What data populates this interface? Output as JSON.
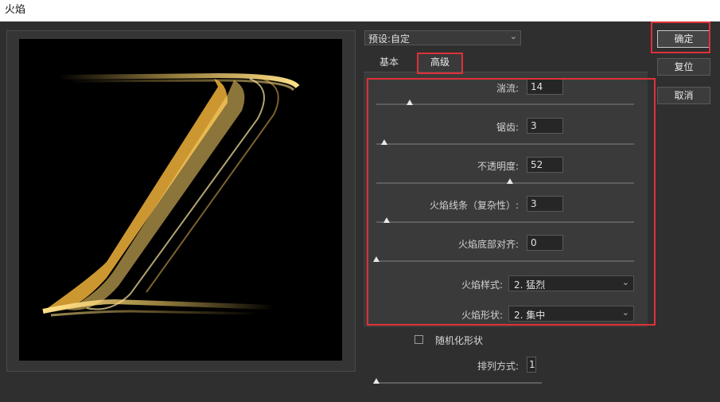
{
  "window": {
    "title": "火焰"
  },
  "preset": {
    "label": "预设:",
    "value": "自定"
  },
  "tabs": [
    {
      "label": "基本"
    },
    {
      "label": "高级"
    }
  ],
  "buttons": {
    "ok": "确定",
    "reset": "复位",
    "cancel": "取消"
  },
  "advanced": {
    "turbulence": {
      "label": "湍流:",
      "value": "14",
      "level": 0.13
    },
    "jagged": {
      "label": "锯齿:",
      "value": "3",
      "level": 0.03
    },
    "opacity": {
      "label": "不透明度:",
      "value": "52",
      "level": 0.52
    },
    "flame_lines": {
      "label": "火焰线条（复杂性）:",
      "value": "3",
      "level": 0.04
    },
    "flame_bottom_align": {
      "label": "火焰底部对齐:",
      "value": "0",
      "level": 0.0
    },
    "flame_style": {
      "label": "火焰样式:",
      "value": "2. 猛烈"
    },
    "flame_shape": {
      "label": "火焰形状:",
      "value": "2. 集中"
    }
  },
  "randomize": {
    "label": "随机化形状",
    "checked": false
  },
  "arrangement": {
    "label": "排列方式:",
    "value": "1",
    "level": 0.0
  },
  "colors": {
    "highlight": "#e0303a",
    "flame_core": "#ffd66b",
    "flame_edge": "#e09a2a"
  },
  "icons": {
    "dropdown": "chevron-down-icon"
  }
}
